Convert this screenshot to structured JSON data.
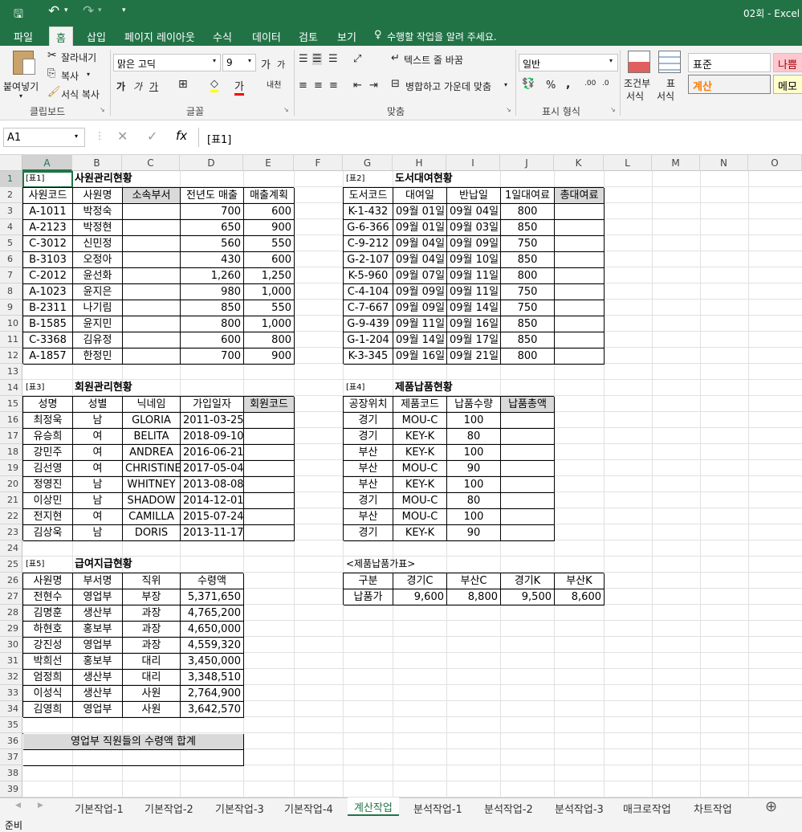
{
  "window": {
    "title": "02회 - Excel"
  },
  "qat": {
    "more_icon": "▾"
  },
  "ribbon_tabs": [
    "파일",
    "홈",
    "삽입",
    "페이지 레이아웃",
    "수식",
    "데이터",
    "검토",
    "보기"
  ],
  "tell_me": "수행할 작업을 알려 주세요.",
  "ribbon": {
    "clipboard": {
      "paste": "붙여넣기",
      "cut": "잘라내기",
      "copy": "복사",
      "format_painter": "서식 복사",
      "group": "클립보드"
    },
    "font": {
      "name": "맑은 고딕",
      "size": "9",
      "group": "글꼴"
    },
    "alignment": {
      "wrap": "텍스트 줄 바꿈",
      "merge": "병합하고 가운데 맞춤",
      "group": "맞춤"
    },
    "number": {
      "format": "일반",
      "group": "표시 형식"
    },
    "styles": {
      "conditional_l1": "조건부",
      "conditional_l2": "서식",
      "table_l1": "표",
      "table_l2": "서식",
      "normal": "표준",
      "bad": "나쁨",
      "calc": "계산",
      "memo": "메모"
    }
  },
  "formula_bar": {
    "name_box": "A1",
    "content": "[표1]"
  },
  "columns": [
    "A",
    "B",
    "C",
    "D",
    "E",
    "F",
    "G",
    "H",
    "I",
    "J",
    "K",
    "L",
    "M",
    "N",
    "O"
  ],
  "rows": [
    "1",
    "2",
    "3",
    "4",
    "5",
    "6",
    "7",
    "8",
    "9",
    "10",
    "11",
    "12",
    "13",
    "14",
    "15",
    "16",
    "17",
    "18",
    "19",
    "20",
    "21",
    "22",
    "23",
    "24",
    "25",
    "26",
    "27",
    "28",
    "29",
    "30",
    "31",
    "32",
    "33",
    "34",
    "35",
    "36",
    "37",
    "38",
    "39"
  ],
  "t1": {
    "tag": "[표1]",
    "title": "사원관리현황",
    "headers": [
      "사원코드",
      "사원명",
      "소속부서",
      "전년도 매출",
      "매출계획"
    ],
    "rows": [
      [
        "A-1011",
        "박정숙",
        "",
        "700",
        "600"
      ],
      [
        "A-2123",
        "박정현",
        "",
        "650",
        "900"
      ],
      [
        "C-3012",
        "신민정",
        "",
        "560",
        "550"
      ],
      [
        "B-3103",
        "오정아",
        "",
        "430",
        "600"
      ],
      [
        "C-2012",
        "윤선화",
        "",
        "1,260",
        "1,250"
      ],
      [
        "A-1023",
        "윤지은",
        "",
        "980",
        "1,000"
      ],
      [
        "B-2311",
        "나기림",
        "",
        "850",
        "550"
      ],
      [
        "B-1585",
        "윤지민",
        "",
        "800",
        "1,000"
      ],
      [
        "C-3368",
        "김유정",
        "",
        "600",
        "800"
      ],
      [
        "A-1857",
        "한정민",
        "",
        "700",
        "900"
      ]
    ]
  },
  "t2": {
    "tag": "[표2]",
    "title": "도서대여현황",
    "headers": [
      "도서코드",
      "대여일",
      "반납일",
      "1일대여료",
      "총대여료"
    ],
    "rows": [
      [
        "K-1-432",
        "09월 01일",
        "09월 04일",
        "800",
        ""
      ],
      [
        "G-6-366",
        "09월 01일",
        "09월 03일",
        "850",
        ""
      ],
      [
        "C-9-212",
        "09월 04일",
        "09월 09일",
        "750",
        ""
      ],
      [
        "G-2-107",
        "09월 04일",
        "09월 10일",
        "850",
        ""
      ],
      [
        "K-5-960",
        "09월 07일",
        "09월 11일",
        "800",
        ""
      ],
      [
        "C-4-104",
        "09월 09일",
        "09월 11일",
        "750",
        ""
      ],
      [
        "C-7-667",
        "09월 09일",
        "09월 14일",
        "750",
        ""
      ],
      [
        "G-9-439",
        "09월 11일",
        "09월 16일",
        "850",
        ""
      ],
      [
        "G-1-204",
        "09월 14일",
        "09월 17일",
        "850",
        ""
      ],
      [
        "K-3-345",
        "09월 16일",
        "09월 21일",
        "800",
        ""
      ]
    ]
  },
  "t3": {
    "tag": "[표3]",
    "title": "회원관리현황",
    "headers": [
      "성명",
      "성별",
      "닉네임",
      "가입일자",
      "회원코드"
    ],
    "rows": [
      [
        "최정욱",
        "남",
        "GLORIA",
        "2011-03-25",
        ""
      ],
      [
        "유승희",
        "여",
        "BELITA",
        "2018-09-10",
        ""
      ],
      [
        "강민주",
        "여",
        "ANDREA",
        "2016-06-21",
        ""
      ],
      [
        "김선영",
        "여",
        "CHRISTINE",
        "2017-05-04",
        ""
      ],
      [
        "정영진",
        "남",
        "WHITNEY",
        "2013-08-08",
        ""
      ],
      [
        "이상민",
        "남",
        "SHADOW",
        "2014-12-01",
        ""
      ],
      [
        "전지현",
        "여",
        "CAMILLA",
        "2015-07-24",
        ""
      ],
      [
        "김상욱",
        "남",
        "DORIS",
        "2013-11-17",
        ""
      ]
    ]
  },
  "t4": {
    "tag": "[표4]",
    "title": "제품납품현황",
    "headers": [
      "공장위치",
      "제품코드",
      "납품수량",
      "납품총액"
    ],
    "rows": [
      [
        "경기",
        "MOU-C",
        "100",
        ""
      ],
      [
        "경기",
        "KEY-K",
        "80",
        ""
      ],
      [
        "부산",
        "KEY-K",
        "100",
        ""
      ],
      [
        "부산",
        "MOU-C",
        "90",
        ""
      ],
      [
        "부산",
        "KEY-K",
        "100",
        ""
      ],
      [
        "경기",
        "MOU-C",
        "80",
        ""
      ],
      [
        "부산",
        "MOU-C",
        "100",
        ""
      ],
      [
        "경기",
        "KEY-K",
        "90",
        ""
      ]
    ]
  },
  "price": {
    "title": "<제품납품가표>",
    "headers": [
      "구분",
      "경기C",
      "부산C",
      "경기K",
      "부산K"
    ],
    "row": [
      "납품가",
      "9,600",
      "8,800",
      "9,500",
      "8,600"
    ]
  },
  "t5": {
    "tag": "[표5]",
    "title": "급여지급현황",
    "headers": [
      "사원명",
      "부서명",
      "직위",
      "수령액"
    ],
    "rows": [
      [
        "전현수",
        "영업부",
        "부장",
        "5,371,650"
      ],
      [
        "김명훈",
        "생산부",
        "과장",
        "4,765,200"
      ],
      [
        "하현호",
        "홍보부",
        "과장",
        "4,650,000"
      ],
      [
        "강진성",
        "영업부",
        "과장",
        "4,559,320"
      ],
      [
        "박희선",
        "홍보부",
        "대리",
        "3,450,000"
      ],
      [
        "엄정희",
        "생산부",
        "대리",
        "3,348,510"
      ],
      [
        "이성식",
        "생산부",
        "사원",
        "2,764,900"
      ],
      [
        "김영희",
        "영업부",
        "사원",
        "3,642,570"
      ]
    ]
  },
  "sum_label": "영업부 직원들의 수령액 합계",
  "sheet_tabs": [
    "기본작업-1",
    "기본작업-2",
    "기본작업-3",
    "기본작업-4",
    "계산작업",
    "분석작업-1",
    "분석작업-2",
    "분석작업-3",
    "매크로작업",
    "차트작업"
  ],
  "active_sheet": "계산작업",
  "status": "준비"
}
